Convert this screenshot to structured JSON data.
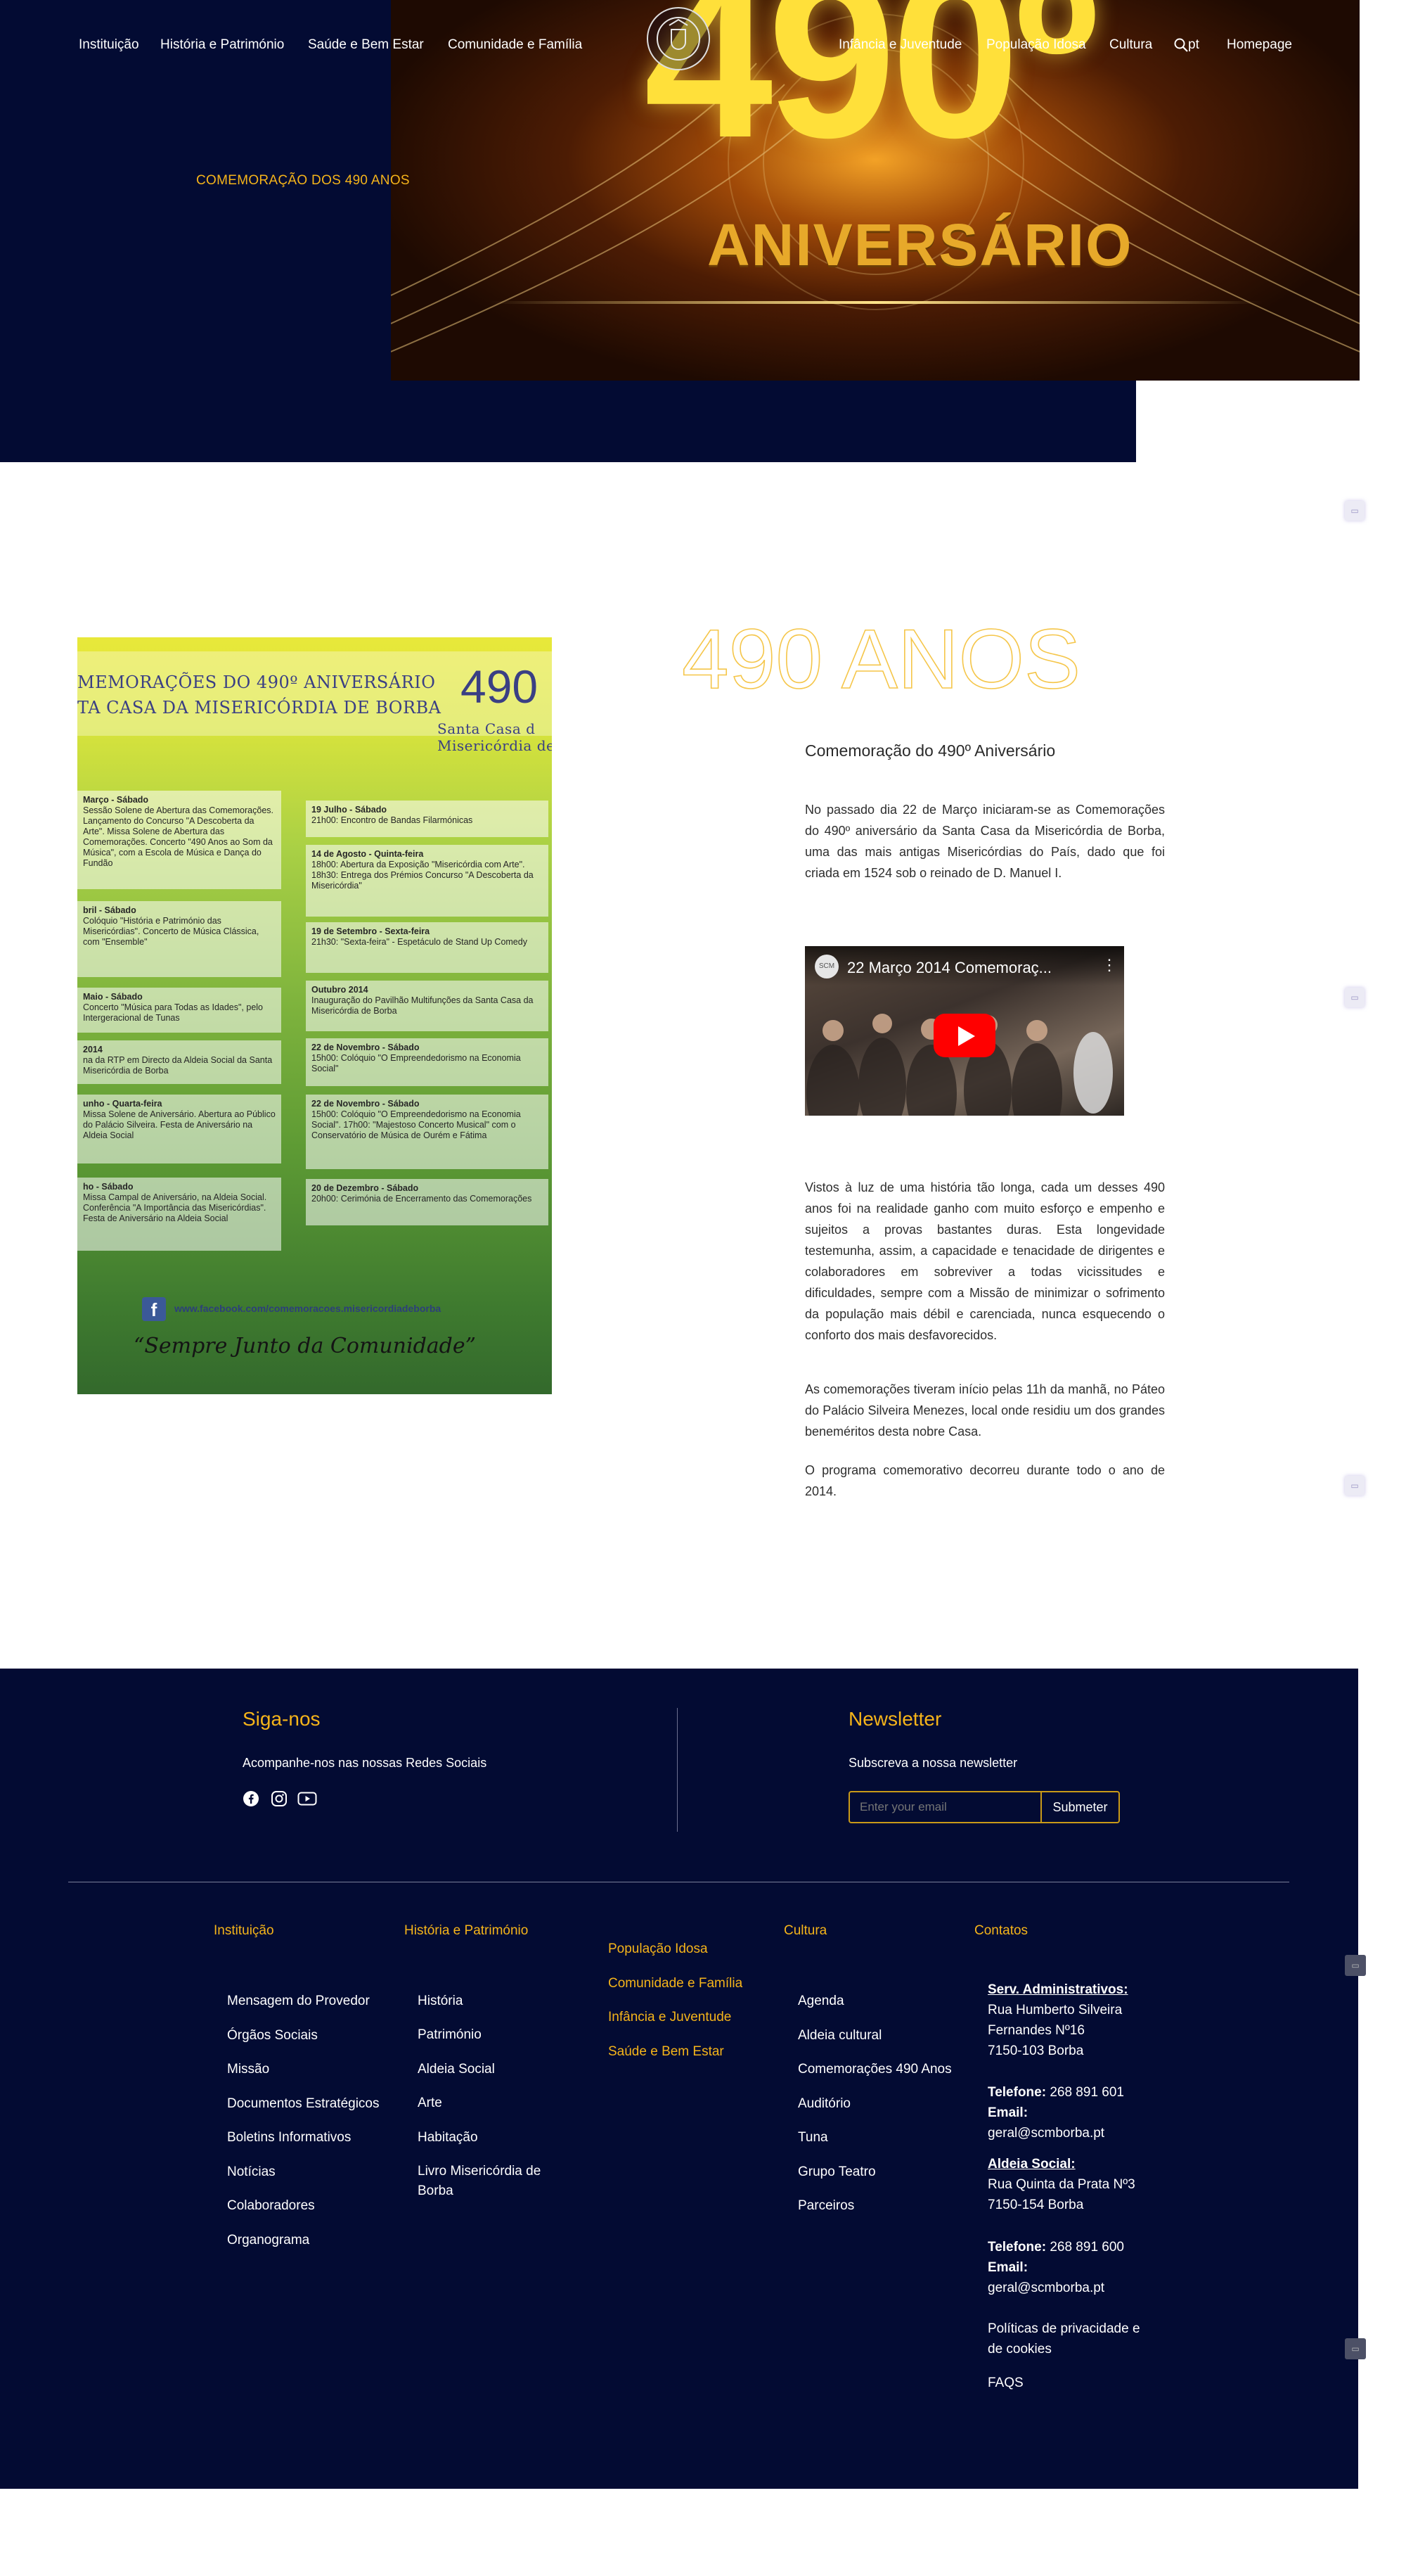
{
  "nav": {
    "left_items": [
      "Instituição",
      "História e Património",
      "Saúde e Bem Estar",
      "Comunidade e Família"
    ],
    "right_items": [
      "Infância e Juventude",
      "População Idosa",
      "Cultura"
    ],
    "language": "pt",
    "homepage": "Homepage"
  },
  "hero": {
    "caption": "COMEMORAÇÃO DOS 490 ANOS",
    "image_number": "490º",
    "image_word": "ANIVERSÁRIO"
  },
  "poster": {
    "title_line1": "MEMORAÇÕES DO 490º ANIVERSÁRIO",
    "title_line2": "TA CASA DA MISERICÓRDIA DE BORBA",
    "number": "490",
    "org_line1": "Santa Casa d",
    "org_line2": "Misericórdia de Borb",
    "left_events": [
      {
        "date": "Março - Sábado",
        "text": "Sessão Solene de Abertura das Comemorações. Lançamento do Concurso \"A Descoberta da Arte\". Missa Solene de Abertura das Comemorações. Concerto \"490 Anos ao Som da Música\", com a Escola de Música e Dança do Fundão"
      },
      {
        "date": "bril - Sábado",
        "text": "Colóquio \"História e Património das Misericórdias\". Concerto de Música Clássica, com \"Ensemble\""
      },
      {
        "date": "Maio - Sábado",
        "text": "Concerto \"Música para Todas as Idades\", pelo Intergeracional de Tunas"
      },
      {
        "date": "2014",
        "text": "na da RTP em Directo da Aldeia Social da Santa Misericórdia de Borba"
      },
      {
        "date": "unho - Quarta-feira",
        "text": "Missa Solene de Aniversário. Abertura ao Público do Palácio Silveira. Festa de Aniversário na Aldeia Social"
      },
      {
        "date": "ho - Sábado",
        "text": "Missa Campal de Aniversário, na Aldeia Social. Conferência \"A Importância das Misericórdias\". Festa de Aniversário na Aldeia Social"
      }
    ],
    "right_events": [
      {
        "date": "19 Julho - Sábado",
        "text": "21h00: Encontro de Bandas Filarmónicas"
      },
      {
        "date": "14 de Agosto - Quinta-feira",
        "text": "18h00: Abertura da Exposição \"Misericórdia com Arte\". 18h30: Entrega dos Prémios Concurso \"A Descoberta da Misericórdia\""
      },
      {
        "date": "19 de Setembro - Sexta-feira",
        "text": "21h30: \"Sexta-feira\" - Espetáculo de Stand Up Comedy"
      },
      {
        "date": "Outubro 2014",
        "text": "Inauguração do Pavilhão Multifunções da Santa Casa da Misericórdia de Borba"
      },
      {
        "date": "22 de Novembro - Sábado",
        "text": "15h00: Colóquio \"O Empreendedorismo na Economia Social\""
      },
      {
        "date": "22 de Novembro - Sábado",
        "text": "15h00: Colóquio \"O Empreendedorismo na Economia Social\". 17h00: \"Majestoso Concerto Musical\" com o Conservatório de Música de Ourém e Fátima"
      },
      {
        "date": "20 de Dezembro - Sábado",
        "text": "20h00: Cerimónia de Encerramento das Comemorações"
      }
    ],
    "facebook_url_text": "www.facebook.com/comemoracoes.misericordiadeborba",
    "slogan": "“Sempre Junto da Comunidade”"
  },
  "content": {
    "big_title": "490 ANOS",
    "subtitle": "Comemoração do 490º Aniversário",
    "para1": "No passado dia 22 de Março iniciaram-se as Comemorações do 490º aniversário da Santa Casa da Misericórdia de Borba, uma das mais antigas Misericórdias do País, dado que foi criada em 1524 sob o reinado de D. Manuel I.",
    "video_title": "22 Março 2014 Comemoraç...",
    "para2": "Vistos à luz de uma história tão longa, cada um desses 490 anos foi na realidade ganho com muito esforço e empenho e sujeitos a provas bastantes duras. Esta longevidade testemunha, assim, a capacidade e tenacidade de dirigentes e colaboradores em sobreviver a todas vicissitudes e dificuldades, sempre com a Missão de minimizar o sofrimento da população mais débil e carenciada, nunca esquecendo o conforto dos mais desfavorecidos.",
    "para3": "As comemorações tiveram início pelas 11h da manhã, no Páteo do Palácio Silveira Menezes, local onde residiu um dos grandes beneméritos desta nobre Casa.",
    "para4": "O programa comemorativo decorreu durante todo o ano de 2014."
  },
  "footer": {
    "follow_title": "Siga-nos",
    "follow_text": "Acompanhe-nos nas nossas Redes Sociais",
    "newsletter_title": "Newsletter",
    "newsletter_text": "Subscreva a nossa newsletter",
    "email_placeholder": "Enter your email",
    "submit_label": "Submeter",
    "col_instituicao": {
      "title": "Instituição",
      "links": [
        "Mensagem do Provedor",
        "Órgãos Sociais",
        "Missão",
        "Documentos Estratégicos",
        "Boletins Informativos",
        "Notícias",
        "Colaboradores",
        "Organograma"
      ]
    },
    "col_historia": {
      "title": "História e Património",
      "links": [
        "História",
        "Património",
        "Aldeia Social",
        "Arte",
        "Habitação",
        "Livro Misericórdia de",
        "Borba"
      ]
    },
    "col_middle": [
      "População Idosa",
      "Comunidade e Família",
      "Infância e Juventude",
      "Saúde e Bem Estar"
    ],
    "col_cultura": {
      "title": "Cultura",
      "links": [
        "Agenda",
        "Aldeia cultural",
        "Comemorações 490 Anos",
        "Auditório",
        "Tuna",
        "Grupo Teatro",
        "Parceiros"
      ]
    },
    "contacts": {
      "title": "Contatos",
      "admin_label": "Serv. Administrativos:",
      "admin_address1": "Rua Humberto Silveira",
      "admin_address2": "Fernandes Nº16",
      "admin_address3": "7150-103 Borba",
      "phone_label": "Telefone:",
      "admin_phone": "268 891 601",
      "email_label": "Email:",
      "admin_email": "geral@scmborba.pt",
      "aldeia_label": "Aldeia Social:",
      "aldeia_address1": "Rua Quinta da Prata Nº3",
      "aldeia_address2": "7150-154 Borba",
      "aldeia_phone": "268 891 600",
      "aldeia_email": "geral@scmborba.pt",
      "privacy_line1": "Políticas de privacidade e",
      "privacy_line2": "de cookies",
      "faqs": "FAQS"
    }
  },
  "colors": {
    "navy": "#030b33",
    "accent": "#f5b41a"
  }
}
